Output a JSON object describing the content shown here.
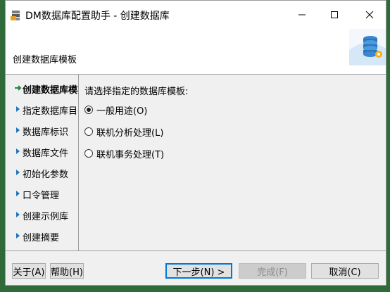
{
  "window": {
    "title": "DM数据库配置助手 - 创建数据库"
  },
  "header": {
    "title": "创建数据库模板"
  },
  "nav": {
    "items": [
      {
        "label": "创建数据库模板",
        "active": true
      },
      {
        "label": "指定数据库目录"
      },
      {
        "label": "数据库标识"
      },
      {
        "label": "数据库文件"
      },
      {
        "label": "初始化参数"
      },
      {
        "label": "口令管理"
      },
      {
        "label": "创建示例库"
      },
      {
        "label": "创建摘要"
      }
    ]
  },
  "content": {
    "prompt": "请选择指定的数据库模板:",
    "options": [
      {
        "label": "一般用途(O)",
        "checked": true
      },
      {
        "label": "联机分析处理(L)",
        "checked": false
      },
      {
        "label": "联机事务处理(T)",
        "checked": false
      }
    ]
  },
  "footer": {
    "about": "关于(A)",
    "help": "帮助(H)",
    "next": "下一步(N) >",
    "finish": "完成(F)",
    "cancel": "取消(C)"
  },
  "colors": {
    "nav_arrow": "#1e73be",
    "active_arrow": "#1e8a3c",
    "accent": "#0078d7"
  }
}
